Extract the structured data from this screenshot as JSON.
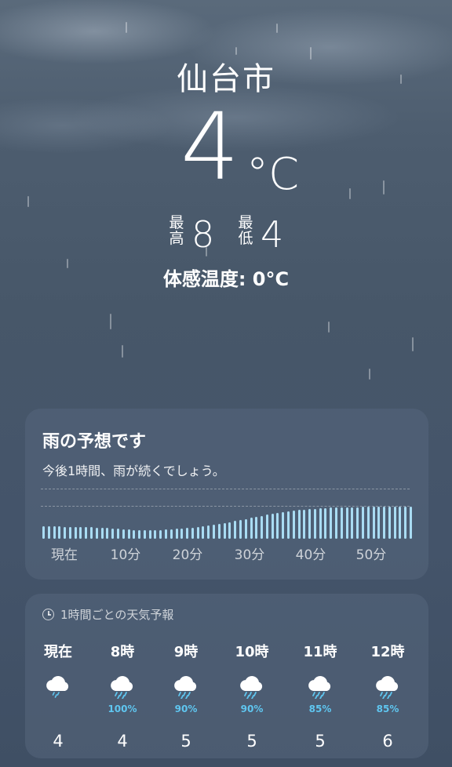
{
  "location": {
    "city": "仙台市"
  },
  "current": {
    "temperature": "4",
    "unit": "°C",
    "high_label": "最\n高",
    "high": "8",
    "low_label": "最\n低",
    "low": "4",
    "feels_like": "体感温度: 0°C"
  },
  "precip_card": {
    "title": "雨の予想です",
    "subtitle": "今後1時間、雨が続くでしょう。",
    "x_labels": [
      "現在",
      "10分",
      "20分",
      "30分",
      "40分",
      "50分"
    ],
    "intensity": [
      0.34,
      0.34,
      0.34,
      0.34,
      0.33,
      0.33,
      0.33,
      0.33,
      0.32,
      0.32,
      0.31,
      0.31,
      0.3,
      0.29,
      0.28,
      0.27,
      0.26,
      0.25,
      0.25,
      0.24,
      0.24,
      0.24,
      0.25,
      0.26,
      0.27,
      0.28,
      0.29,
      0.3,
      0.31,
      0.33,
      0.35,
      0.37,
      0.39,
      0.41,
      0.43,
      0.46,
      0.49,
      0.52,
      0.55,
      0.58,
      0.61,
      0.64,
      0.67,
      0.7,
      0.72,
      0.74,
      0.76,
      0.78,
      0.8,
      0.81,
      0.82,
      0.83,
      0.84,
      0.85,
      0.86,
      0.87,
      0.87,
      0.88,
      0.88,
      0.88,
      0.89,
      0.89,
      0.89,
      0.9,
      0.9,
      0.9,
      0.9,
      0.9,
      0.9,
      0.9
    ],
    "bar_color": "#a9dcf3"
  },
  "hourly_card": {
    "header": "1時間ごとの天気予報",
    "header_icon": "clock-icon",
    "hours": [
      {
        "time": "現在",
        "icon": "cloud-rain-light-icon",
        "pop": "",
        "temp": "4"
      },
      {
        "time": "8時",
        "icon": "cloud-rain-icon",
        "pop": "100%",
        "temp": "4"
      },
      {
        "time": "9時",
        "icon": "cloud-rain-icon",
        "pop": "90%",
        "temp": "5"
      },
      {
        "time": "10時",
        "icon": "cloud-rain-icon",
        "pop": "90%",
        "temp": "5"
      },
      {
        "time": "11時",
        "icon": "cloud-rain-icon",
        "pop": "85%",
        "temp": "5"
      },
      {
        "time": "12時",
        "icon": "cloud-rain-icon",
        "pop": "85%",
        "temp": "6"
      }
    ],
    "pop_color": "#5fc6f0"
  }
}
